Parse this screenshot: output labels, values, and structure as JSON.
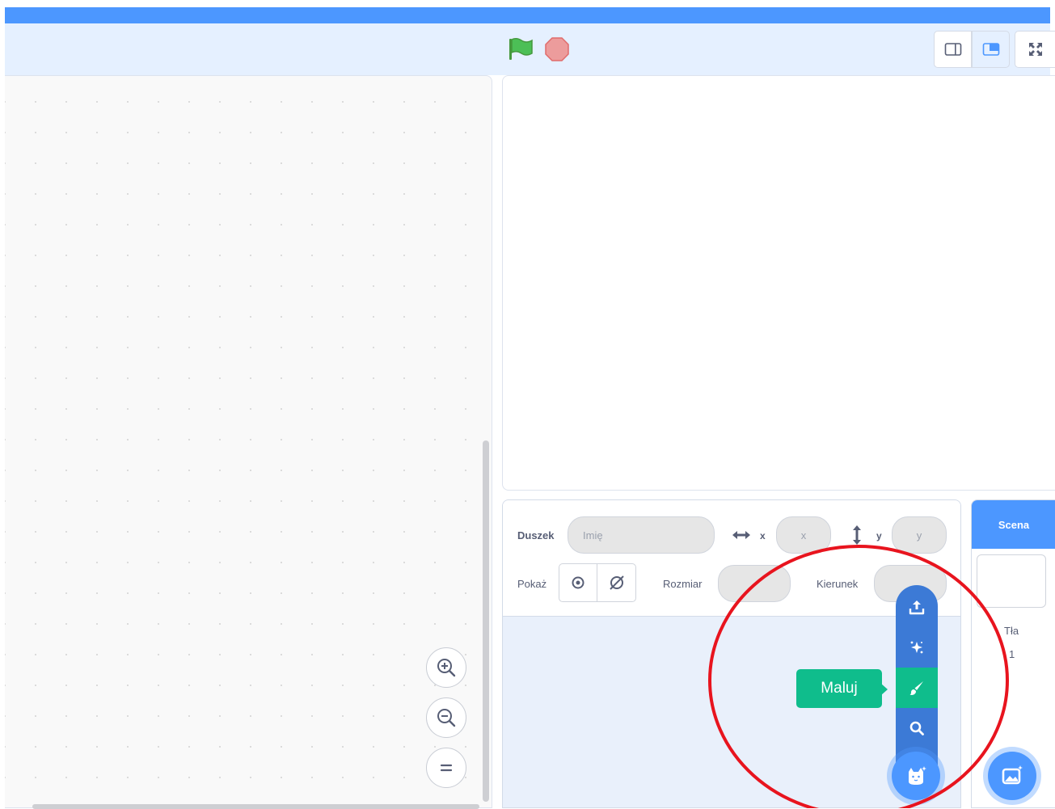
{
  "sprite_info": {
    "sprite_label": "Duszek",
    "name_placeholder": "Imię",
    "x_label": "x",
    "x_placeholder": "x",
    "y_label": "y",
    "y_placeholder": "y",
    "show_label": "Pokaż",
    "size_label": "Rozmiar",
    "direction_label": "Kierunek"
  },
  "scene_panel": {
    "header": "Scena",
    "backdrops_label": "Tła",
    "backdrops_count": "1"
  },
  "sprite_menu": {
    "items": [
      "upload-icon",
      "surprise-icon",
      "paint-icon",
      "search-icon"
    ],
    "tooltip": "Maluj",
    "active_color": "#0fbd8c"
  },
  "colors": {
    "menubar": "#4c97ff",
    "toolbar": "#e5f0ff",
    "menu": "#3c7ad6",
    "annotation": "#e8141e"
  }
}
